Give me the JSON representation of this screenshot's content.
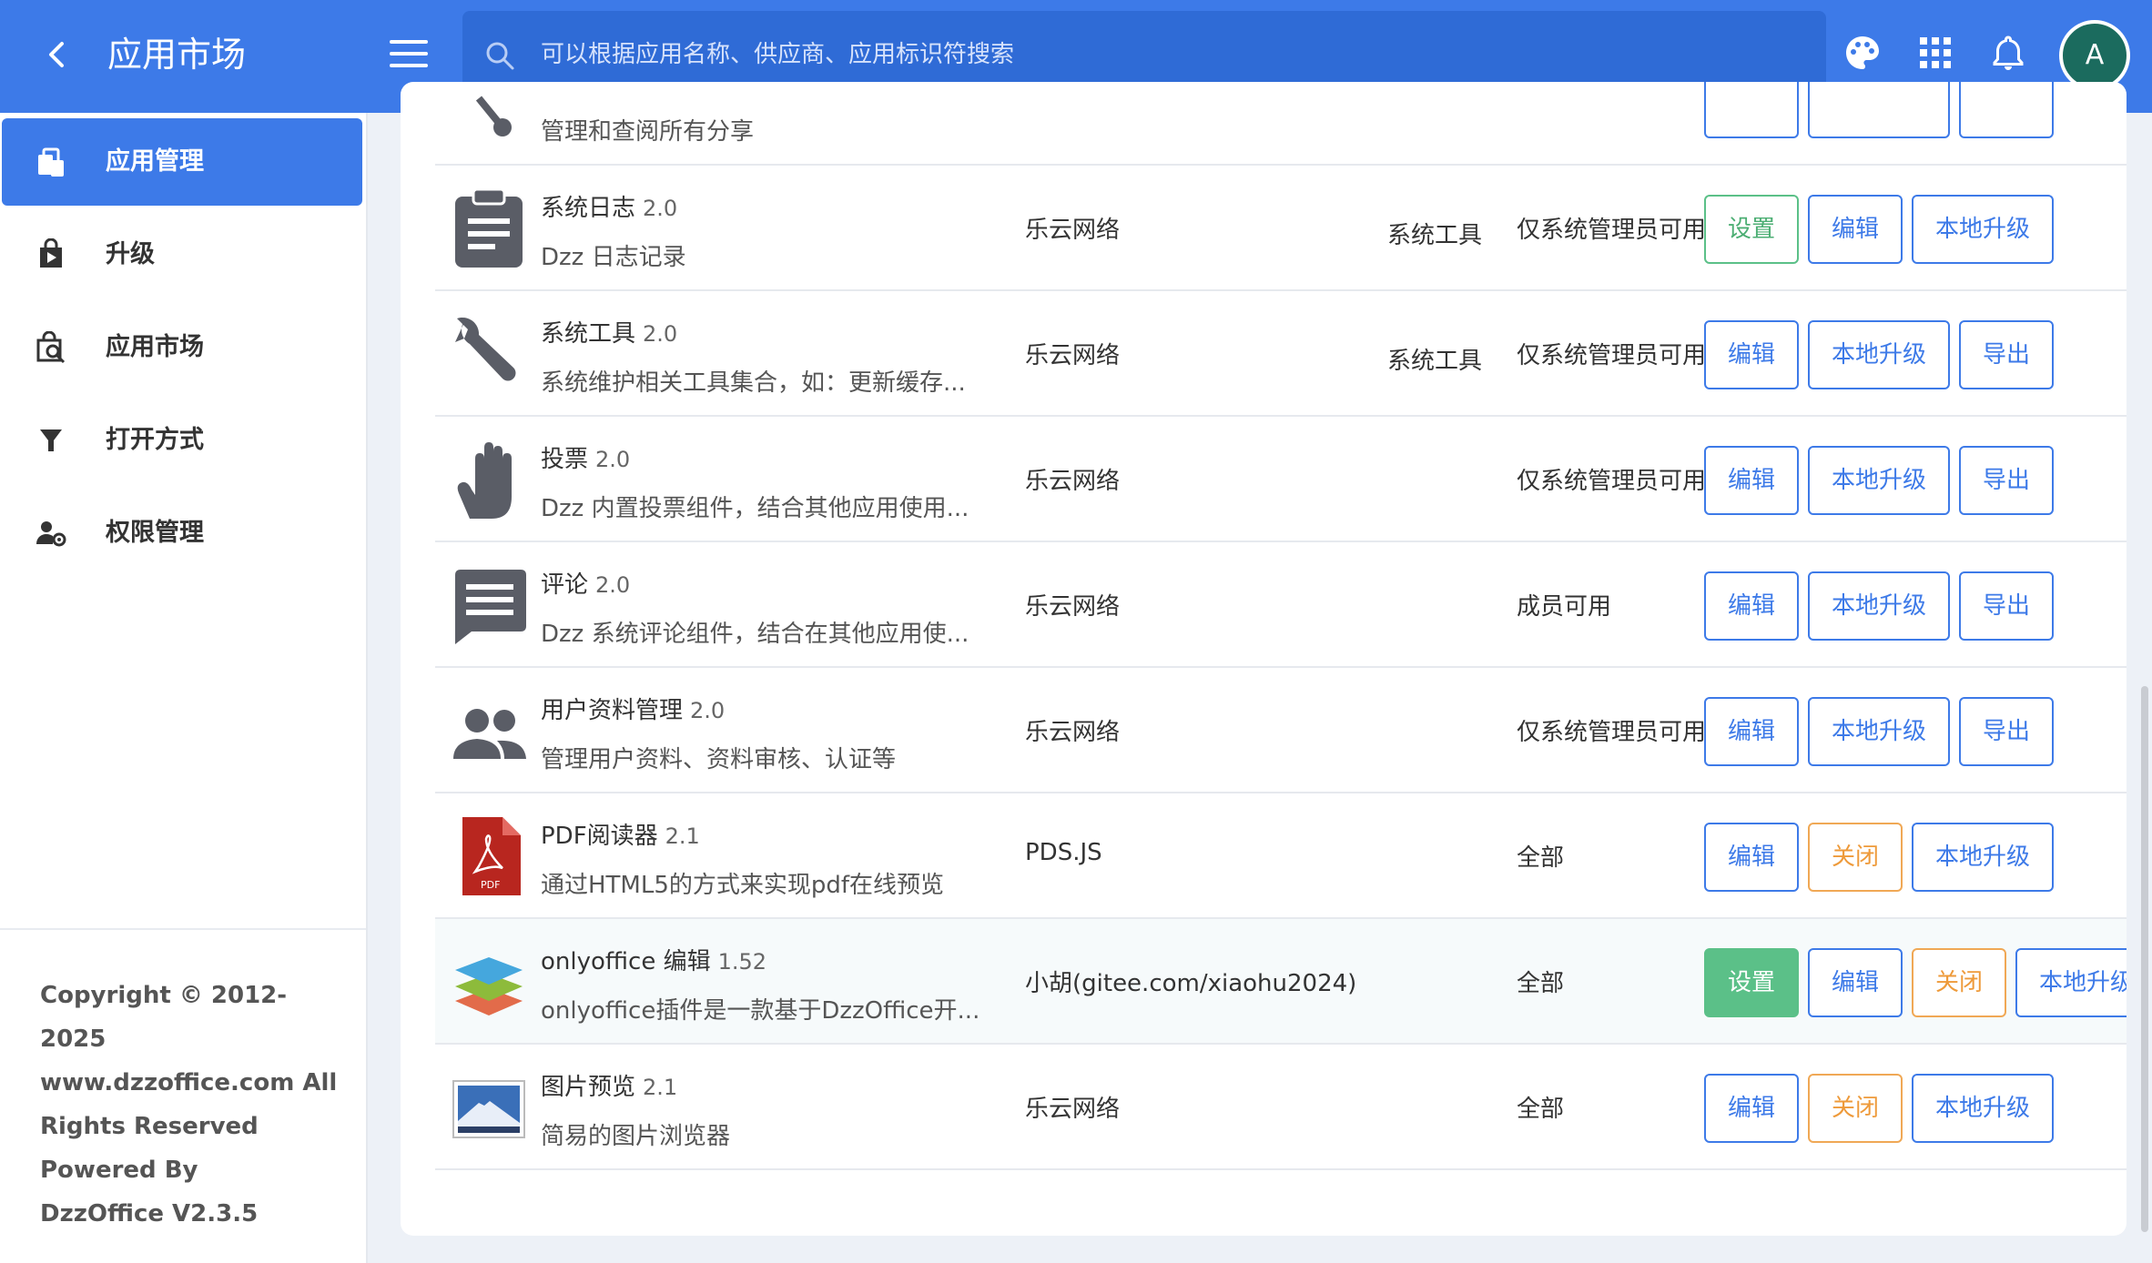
{
  "header": {
    "title": "应用市场",
    "search_placeholder": "可以根据应用名称、供应商、应用标识符搜索",
    "avatar_initial": "A",
    "brand_color": "#3d7ae8"
  },
  "sidebar": {
    "items": [
      {
        "label": "应用管理",
        "icon": "app-manage-icon",
        "active": true
      },
      {
        "label": "升级",
        "icon": "upgrade-icon",
        "active": false
      },
      {
        "label": "应用市场",
        "icon": "market-icon",
        "active": false
      },
      {
        "label": "打开方式",
        "icon": "filter-icon",
        "active": false
      },
      {
        "label": "权限管理",
        "icon": "user-settings-icon",
        "active": false
      }
    ],
    "copyright_lines": [
      "Copyright © 2012-2025",
      "www.dzzoffice.com All",
      "Rights Reserved",
      "Powered By",
      "DzzOffice V2.3.5"
    ]
  },
  "apps": [
    {
      "name": "",
      "version": "",
      "desc": "管理和查阅所有分享",
      "vendor": "",
      "category": "",
      "access": "",
      "icon": "share-icon",
      "buttons": []
    },
    {
      "name": "系统日志",
      "version": "2.0",
      "desc": "Dzz 日志记录",
      "vendor": "乐云网络",
      "category": "系统工具",
      "access": "仅系统管理员可用",
      "icon": "clipboard-icon",
      "buttons": [
        {
          "label": "设置",
          "style": "success"
        },
        {
          "label": "编辑",
          "style": "primary"
        },
        {
          "label": "本地升级",
          "style": "primary"
        }
      ]
    },
    {
      "name": "系统工具",
      "version": "2.0",
      "desc": "系统维护相关工具集合，如：更新缓存...",
      "vendor": "乐云网络",
      "category": "系统工具",
      "access": "仅系统管理员可用",
      "icon": "wrench-icon",
      "buttons": [
        {
          "label": "编辑",
          "style": "primary"
        },
        {
          "label": "本地升级",
          "style": "primary"
        },
        {
          "label": "导出",
          "style": "primary"
        }
      ]
    },
    {
      "name": "投票",
      "version": "2.0",
      "desc": "Dzz 内置投票组件，结合其他应用使用...",
      "vendor": "乐云网络",
      "category": "",
      "access": "仅系统管理员可用",
      "icon": "hand-icon",
      "buttons": [
        {
          "label": "编辑",
          "style": "primary"
        },
        {
          "label": "本地升级",
          "style": "primary"
        },
        {
          "label": "导出",
          "style": "primary"
        }
      ]
    },
    {
      "name": "评论",
      "version": "2.0",
      "desc": "Dzz 系统评论组件，结合在其他应用使...",
      "vendor": "乐云网络",
      "category": "",
      "access": "成员可用",
      "icon": "comment-icon",
      "buttons": [
        {
          "label": "编辑",
          "style": "primary"
        },
        {
          "label": "本地升级",
          "style": "primary"
        },
        {
          "label": "导出",
          "style": "primary"
        }
      ]
    },
    {
      "name": "用户资料管理",
      "version": "2.0",
      "desc": "管理用户资料、资料审核、认证等",
      "vendor": "乐云网络",
      "category": "",
      "access": "仅系统管理员可用",
      "icon": "users-icon",
      "buttons": [
        {
          "label": "编辑",
          "style": "primary"
        },
        {
          "label": "本地升级",
          "style": "primary"
        },
        {
          "label": "导出",
          "style": "primary"
        }
      ]
    },
    {
      "name": "PDF阅读器",
      "version": "2.1",
      "desc": "通过HTML5的方式来实现pdf在线预览",
      "vendor": "PDS.JS",
      "category": "",
      "access": "全部",
      "icon": "pdf-file-icon",
      "buttons": [
        {
          "label": "编辑",
          "style": "primary"
        },
        {
          "label": "关闭",
          "style": "warning"
        },
        {
          "label": "本地升级",
          "style": "primary"
        }
      ]
    },
    {
      "name": "onlyoffice 编辑",
      "version": "1.52",
      "desc": "onlyoffice插件是一款基于DzzOffice开...",
      "vendor": "小胡(gitee.com/xiaohu2024)",
      "category": "",
      "access": "全部",
      "icon": "onlyoffice-layers-icon",
      "highlight": true,
      "buttons": [
        {
          "label": "设置",
          "style": "success-solid"
        },
        {
          "label": "编辑",
          "style": "primary"
        },
        {
          "label": "关闭",
          "style": "warning"
        },
        {
          "label": "本地升级",
          "style": "primary"
        }
      ]
    },
    {
      "name": "图片预览",
      "version": "2.1",
      "desc": "简易的图片浏览器",
      "vendor": "乐云网络",
      "category": "",
      "access": "全部",
      "icon": "image-preview-icon",
      "buttons": [
        {
          "label": "编辑",
          "style": "primary"
        },
        {
          "label": "关闭",
          "style": "warning"
        },
        {
          "label": "本地升级",
          "style": "primary"
        }
      ]
    }
  ]
}
